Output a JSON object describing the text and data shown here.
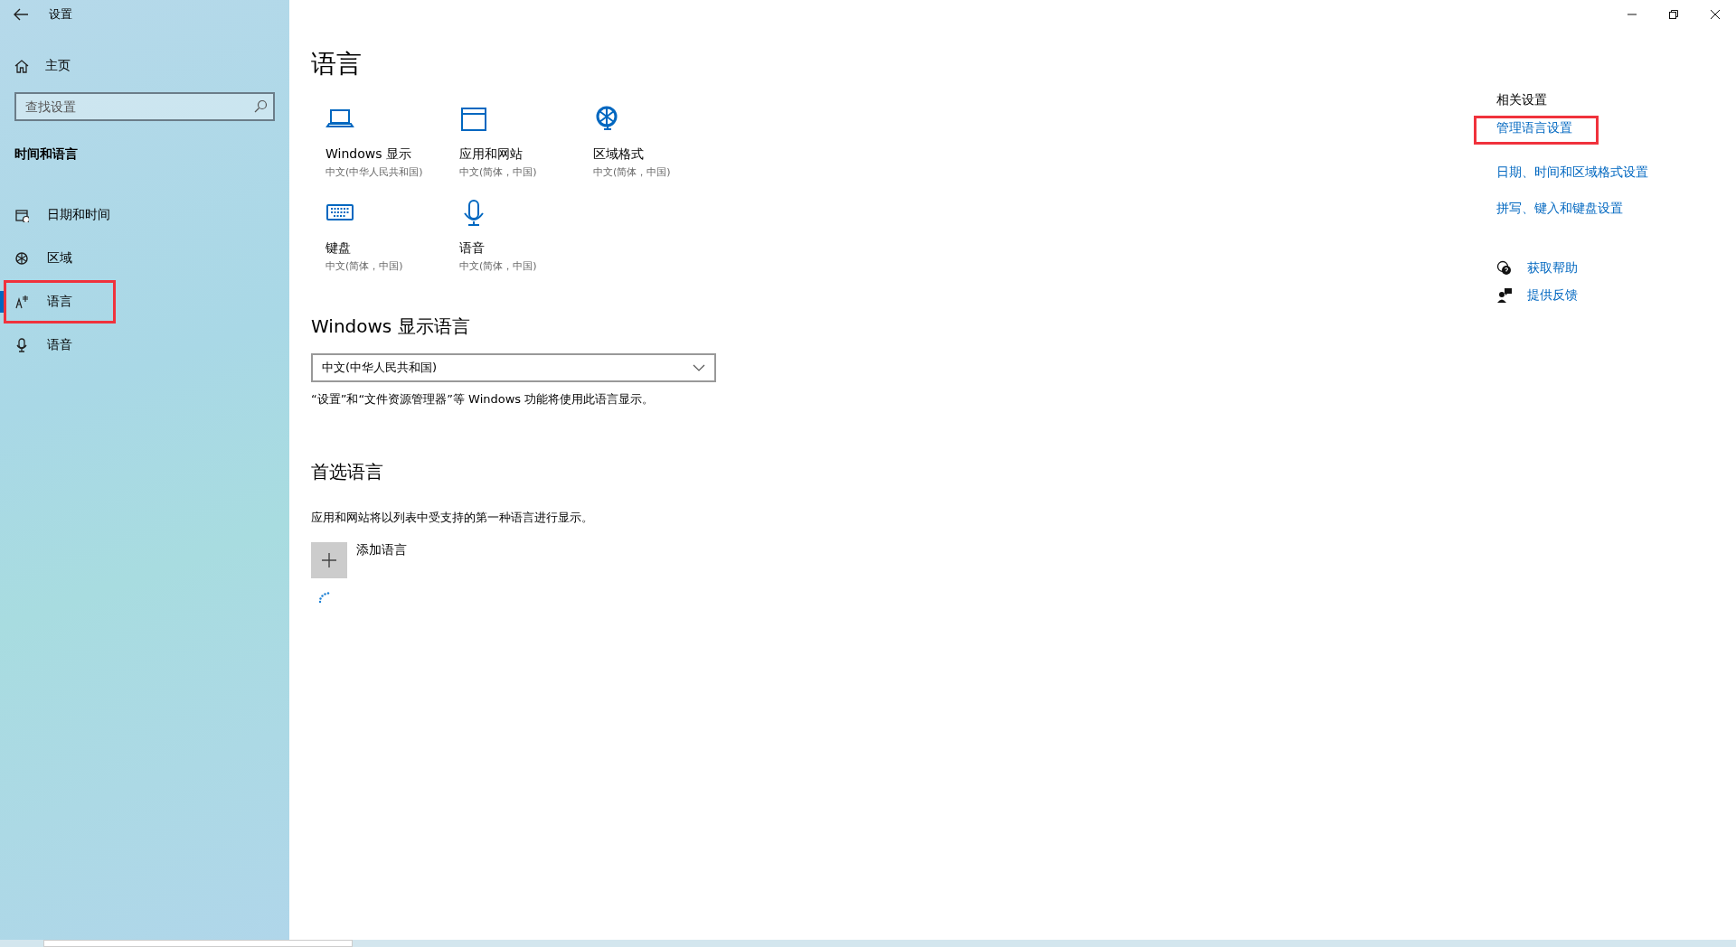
{
  "window": {
    "title": "设置"
  },
  "sidebar": {
    "home": "主页",
    "search": {
      "placeholder": "查找设置"
    },
    "section": "时间和语言",
    "items": [
      {
        "label": "日期和时间",
        "selected": false,
        "annotated": false
      },
      {
        "label": "区域",
        "selected": false,
        "annotated": false
      },
      {
        "label": "语言",
        "selected": true,
        "annotated": true
      },
      {
        "label": "语音",
        "selected": false,
        "annotated": false
      }
    ]
  },
  "main": {
    "title": "语言",
    "tiles": [
      {
        "label": "Windows 显示",
        "sub": "中文(中华人民共和国)"
      },
      {
        "label": "应用和网站",
        "sub": "中文(简体，中国)"
      },
      {
        "label": "区域格式",
        "sub": "中文(简体，中国)"
      },
      {
        "label": "键盘",
        "sub": "中文(简体，中国)"
      },
      {
        "label": "语音",
        "sub": "中文(简体，中国)"
      }
    ],
    "display_language": {
      "heading": "Windows 显示语言",
      "value": "中文(中华人民共和国)",
      "note": "“设置”和“文件资源管理器”等 Windows 功能将使用此语言显示。"
    },
    "preferred": {
      "heading": "首选语言",
      "description": "应用和网站将以列表中受支持的第一种语言进行显示。",
      "add_label": "添加语言"
    }
  },
  "related": {
    "heading": "相关设置",
    "links": [
      {
        "label": "管理语言设置",
        "annotated": true
      },
      {
        "label": "日期、时间和区域格式设置",
        "annotated": false
      },
      {
        "label": "拼写、键入和键盘设置",
        "annotated": false
      }
    ]
  },
  "help": [
    {
      "label": "获取帮助"
    },
    {
      "label": "提供反馈"
    }
  ]
}
